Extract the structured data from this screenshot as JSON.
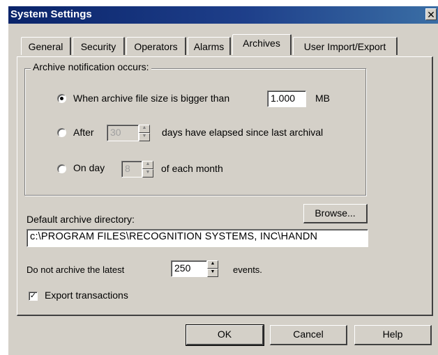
{
  "window": {
    "title": "System Settings",
    "close_glyph": "✕"
  },
  "tabs": [
    {
      "label": "General"
    },
    {
      "label": "Security"
    },
    {
      "label": "Operators"
    },
    {
      "label": "Alarms"
    },
    {
      "label": "Archives",
      "active": true
    },
    {
      "label": "User Import/Export"
    }
  ],
  "archive_notification": {
    "legend": "Archive notification occurs:",
    "size_option": {
      "label": "When archive file size is bigger than",
      "value": "1.000",
      "unit": "MB",
      "selected": true
    },
    "after_option": {
      "label": "After",
      "value": "30",
      "suffix": "days have elapsed since last archival",
      "selected": false
    },
    "day_option": {
      "label": "On day",
      "value": "8",
      "suffix": "of each month",
      "selected": false
    }
  },
  "directory": {
    "label": "Default archive directory:",
    "browse_label": "Browse...",
    "value": "c:\\PROGRAM FILES\\RECOGNITION SYSTEMS, INC\\HANDN"
  },
  "latest": {
    "prefix": "Do not archive the latest",
    "value": "250",
    "suffix": "events."
  },
  "export": {
    "label": "Export transactions",
    "checked": true,
    "check_glyph": "✓"
  },
  "buttons": {
    "ok": "OK",
    "cancel": "Cancel",
    "help": "Help"
  },
  "icons": {
    "spin_up": "▲",
    "spin_down": "▼"
  }
}
